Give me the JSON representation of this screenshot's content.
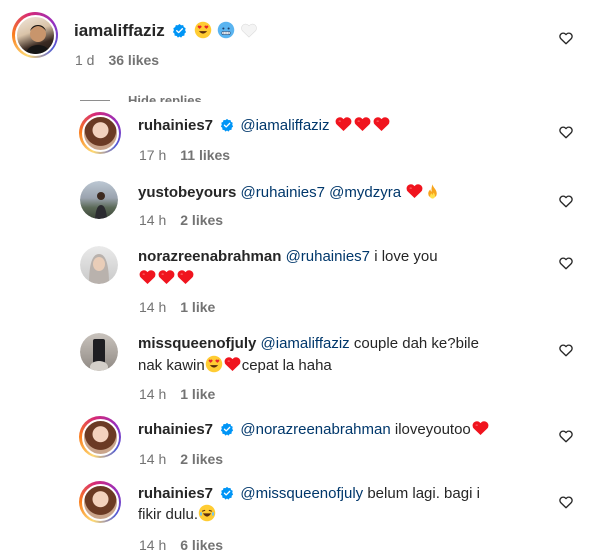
{
  "top_comment": {
    "username": "iamaliffaziz",
    "time": "1 d",
    "likes": "36 likes"
  },
  "hide_replies": "Hide replies",
  "replies": [
    {
      "username": "ruhainies7",
      "mention": "@iamaliffaziz",
      "text": "",
      "time": "17 h",
      "likes": "11 likes"
    },
    {
      "username": "yustobeyours",
      "mention": "@ruhainies7 @mydzyra",
      "text": "",
      "time": "14 h",
      "likes": "2 likes"
    },
    {
      "username": "norazreenabrahman",
      "mention": "@ruhainies7",
      "text": "i love you",
      "time": "14 h",
      "likes": "1 like"
    },
    {
      "username": "missqueenofjuly",
      "mention": "@iamaliffaziz",
      "text": "couple dah ke?bile",
      "text2a": "nak kawin",
      "text2b": "cepat la haha",
      "time": "14 h",
      "likes": "1 like"
    },
    {
      "username": "ruhainies7",
      "mention": "@norazreenabrahman",
      "text": "iloveyoutoo",
      "time": "14 h",
      "likes": "2 likes"
    },
    {
      "username": "ruhainies7",
      "mention": "@missqueenofjuly",
      "text": "belum lagi. bagi i",
      "text2a": "fikir dulu.",
      "time": "14 h",
      "likes": "6 likes"
    }
  ],
  "colors": {
    "heart_red": "#ff2e2e",
    "verified_blue": "#0095f6",
    "mention": "#00376b",
    "meta_gray": "#737373"
  },
  "icons": [
    "heart-outline-icon",
    "verified-badge-icon",
    "heart-eyes-emoji",
    "cold-face-emoji",
    "white-heart-emoji",
    "red-heart-emoji",
    "fire-emoji",
    "laughing-tears-emoji"
  ]
}
